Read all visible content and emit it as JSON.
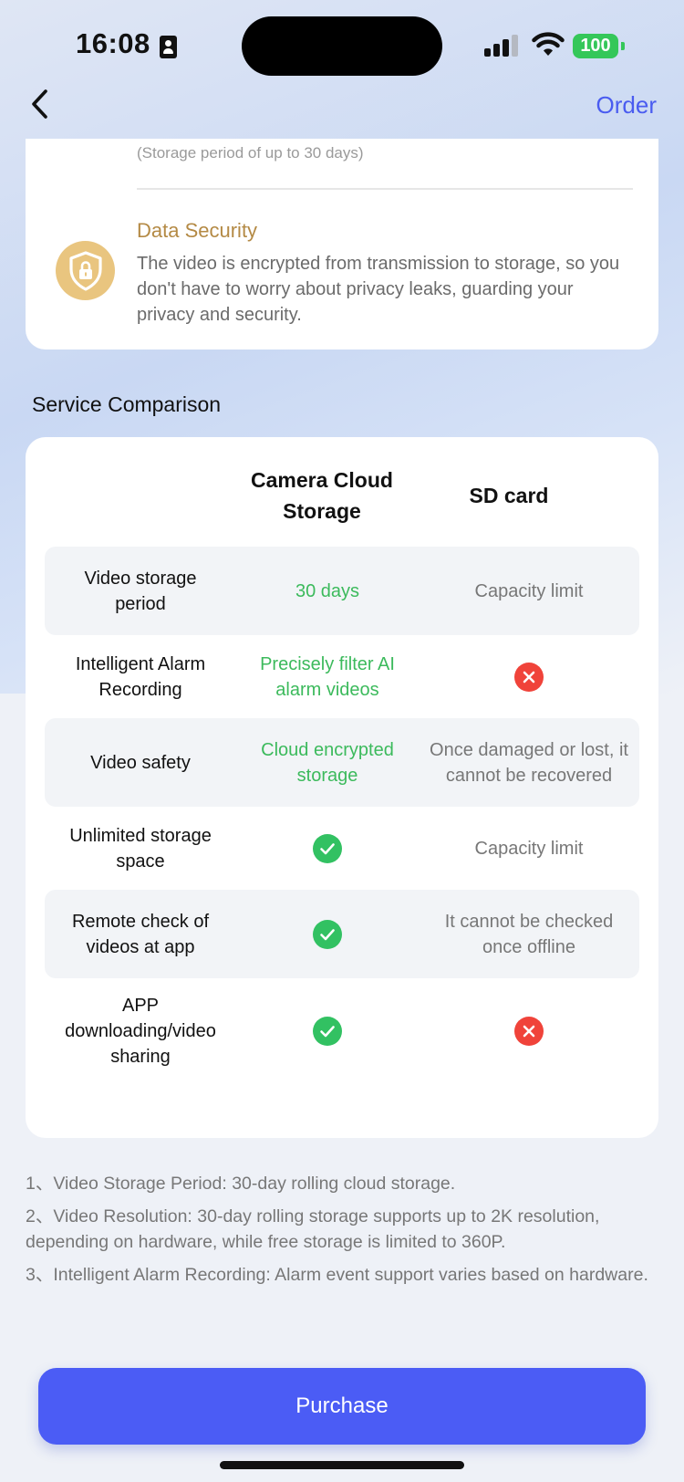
{
  "status_bar": {
    "time": "16:08",
    "battery": "100"
  },
  "nav": {
    "order_label": "Order"
  },
  "features": {
    "storage_note": "(Storage period of up to 30 days)",
    "data_security_title": "Data Security",
    "data_security_desc": "The video is encrypted from transmission to storage, so you don't have to worry about privacy leaks, guarding your privacy and security."
  },
  "comparison": {
    "section_title": "Service Comparison",
    "col_cloud_line1": "Camera Cloud",
    "col_cloud_line2": "Storage",
    "col_sd": "SD card",
    "rows": [
      {
        "feature": "Video storage period",
        "cloud": "30 days",
        "sd": "Capacity limit"
      },
      {
        "feature": "Intelligent Alarm Recording",
        "cloud": "Precisely filter AI alarm videos",
        "sd": ""
      },
      {
        "feature": "Video safety",
        "cloud": "Cloud encrypted storage",
        "sd": "Once damaged or lost, it cannot be recovered"
      },
      {
        "feature": "Unlimited storage space",
        "cloud": "",
        "sd": "Capacity limit"
      },
      {
        "feature": "Remote check of videos at app",
        "cloud": "",
        "sd": "It cannot be checked once offline"
      },
      {
        "feature": "APP downloading/video sharing",
        "cloud": "",
        "sd": ""
      }
    ]
  },
  "notes": [
    "1、Video Storage Period: 30-day rolling cloud storage.",
    "2、Video Resolution: 30-day rolling storage supports up to 2K resolution, depending on hardware, while free storage is limited to 360P.",
    "3、Intelligent Alarm Recording: Alarm event support varies based on hardware."
  ],
  "purchase_label": "Purchase",
  "colors": {
    "accent": "#4b5cf5",
    "positive": "#3cba5c",
    "negative": "#f0433a",
    "gold": "#b48a45"
  }
}
